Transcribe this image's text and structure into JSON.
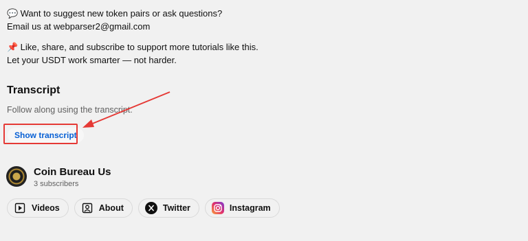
{
  "description": {
    "line1_emoji": "💬",
    "line1": "Want to suggest new token pairs or ask questions?",
    "line2": "Email us at webparser2@gmail.com",
    "line3_emoji": "📌",
    "line3": "Like, share, and subscribe to support more tutorials like this.",
    "line4": "Let your USDT work smarter — not harder."
  },
  "transcript": {
    "title": "Transcript",
    "subtitle": "Follow along using the transcript.",
    "button_label": "Show transcript"
  },
  "channel": {
    "name": "Coin Bureau Us",
    "subscribers": "3 subscribers"
  },
  "links": {
    "videos": "Videos",
    "about": "About",
    "twitter": "Twitter",
    "instagram": "Instagram"
  },
  "colors": {
    "highlight": "#e53935",
    "link_blue": "#065fd4"
  }
}
